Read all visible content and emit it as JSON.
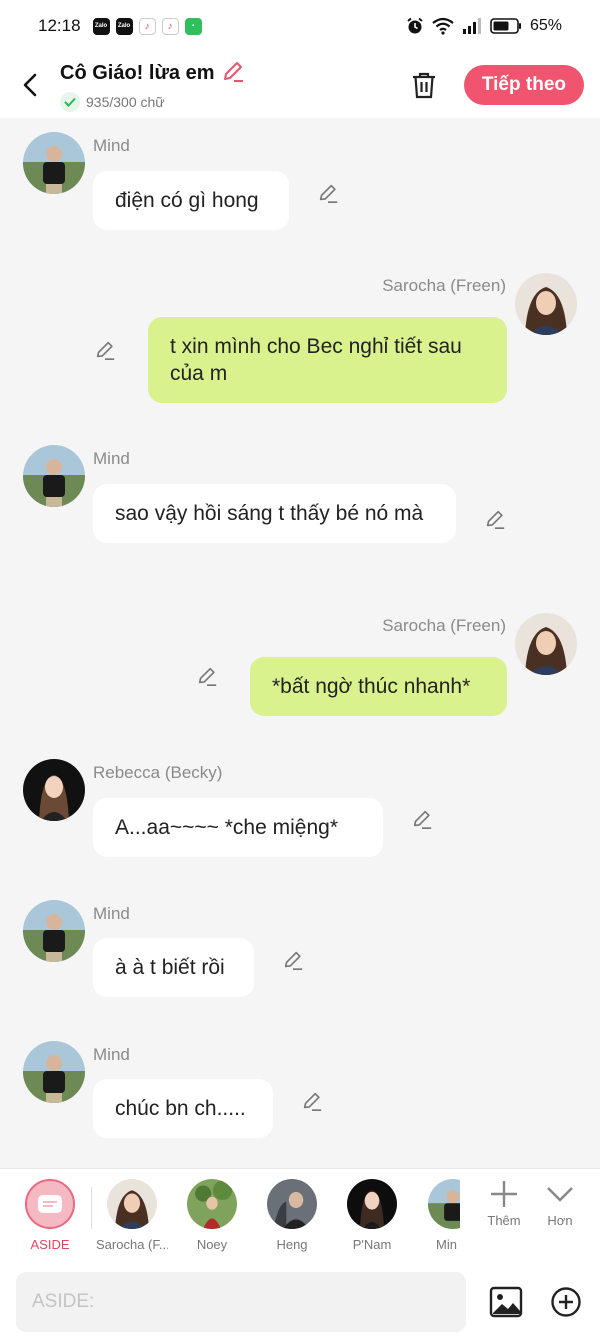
{
  "status_bar": {
    "time": "12:18",
    "apps": [
      "Zalo",
      "Zalo",
      "TikTok",
      "TikTok",
      "Messages"
    ],
    "battery": "65%"
  },
  "header": {
    "title": "Cô Giáo! lừa em",
    "word_count": "935/300 chữ",
    "next_label": "Tiếp theo"
  },
  "messages": [
    {
      "sender": "Mind",
      "side": "left",
      "text": "điện có gì hong"
    },
    {
      "sender": "Sarocha (Freen)",
      "side": "right",
      "text": "t xin mình cho Bec nghỉ tiết sau của m"
    },
    {
      "sender": "Mind",
      "side": "left",
      "text": "sao vậy hồi sáng t thấy bé nó mà"
    },
    {
      "sender": "Sarocha (Freen)",
      "side": "right",
      "text": "*bất ngờ thúc nhanh*"
    },
    {
      "sender": "Rebecca (Becky)",
      "side": "left",
      "text": "A...aa~~~~ *che miệng*"
    },
    {
      "sender": "Mind",
      "side": "left",
      "text": "à à t biết rồi"
    },
    {
      "sender": "Mind",
      "side": "left",
      "text": "chúc bn ch....."
    }
  ],
  "characters": [
    {
      "name": "ASIDE"
    },
    {
      "name": "Sarocha (F..."
    },
    {
      "name": "Noey"
    },
    {
      "name": "Heng"
    },
    {
      "name": "P'Nam"
    },
    {
      "name": "Min"
    }
  ],
  "tools": {
    "add_label": "Thêm",
    "more_label": "Hơn"
  },
  "input": {
    "placeholder": "ASIDE:"
  },
  "colors": {
    "accent": "#f0546e",
    "bubble_right": "#d9f28e",
    "bubble_left": "#ffffff",
    "background": "#f5f5f5"
  }
}
